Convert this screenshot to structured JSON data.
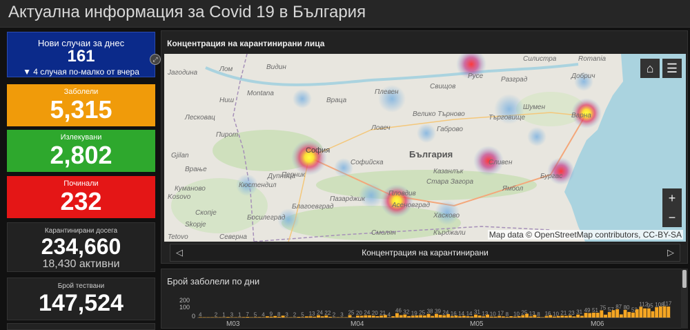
{
  "header": {
    "title": "Актуална информация за Covid 19 в България"
  },
  "cards": {
    "new": {
      "label": "Нови случаи за днес",
      "value": "161",
      "sub": "▼ 4 случая по-малко от вчера"
    },
    "sick": {
      "label": "Заболели",
      "value": "5,315"
    },
    "recovered": {
      "label": "Излекувани",
      "value": "2,802"
    },
    "dead": {
      "label": "Починали",
      "value": "232"
    },
    "quarantined": {
      "label": "Карантинирани досега",
      "value": "234,660",
      "sub": "18,430 активни"
    },
    "tests": {
      "label": "Брой тествани",
      "value": "147,524"
    }
  },
  "map_panel": {
    "title": "Концентрация на карантинирани лица",
    "attribution": "Map data © OpenStreetMap contributors, CC-BY-SA",
    "caption": "Концентрация на карантинирани",
    "zoom_in": "+",
    "zoom_out": "−",
    "labels": {
      "romania": "Romania",
      "dobrich": "Добрич",
      "silistra": "Силистра",
      "ruse": "Русе",
      "razgrad": "Разград",
      "pleven": "Плевен",
      "svishtov": "Свищов",
      "vratsa": "Враца",
      "montana": "Montana",
      "vidin": "Видин",
      "nish": "Ниш",
      "lovech": "Ловеч",
      "vtarnovo": "Велико Търново",
      "shumen": "Шумен",
      "targovishte": "Търговище",
      "gabrovo": "Габрово",
      "sofia": "София",
      "sofiyska": "Софийска",
      "bulgaria": "България",
      "kazanlak": "Казанлък",
      "sliven": "Сливен",
      "yambol": "Ямбол",
      "burgas": "Бургас",
      "varna": "Варна",
      "stzagora": "Стара Загора",
      "kyustendil": "Кюстендил",
      "pazardzhik": "Пазарджик",
      "plovdiv": "Пловдив",
      "asenovgrad": "Асеновград",
      "haskovo": "Хасково",
      "blagoevgrad": "Благоевград",
      "skopje": "Скопје",
      "severna": "Северна",
      "skopje2": "Skopje",
      "kosovo": "Kosovo",
      "pirot": "Пирот",
      "vranje": "Врање",
      "jagodina": "Јагодина",
      "tetovo": "Tetovo",
      "kumanovo": "Куманово",
      "pernik": "Перник",
      "gjilane": "Gjilan",
      "leskovac": "Лесковац",
      "kiustendil2": "Кърджали",
      "smolyan": "Смолян",
      "lom": "Лом",
      "dupnitsa": "Дупница",
      "bosilegrad": "Босилеград"
    }
  },
  "chart_panel": {
    "title": "Брой заболели по дни",
    "y_ticks": [
      "200",
      "100",
      "0"
    ],
    "x_ticks": [
      "M03",
      "M04",
      "M05",
      "M06"
    ]
  },
  "chart_data": {
    "type": "bar",
    "title": "Брой заболели по дни",
    "ylim": [
      0,
      200
    ],
    "x_ticks": [
      "M03",
      "M04",
      "M05",
      "M06"
    ],
    "values": [
      4,
      0,
      0,
      0,
      2,
      1,
      1,
      6,
      3,
      2,
      1,
      5,
      7,
      1,
      5,
      5,
      4,
      13,
      9,
      16,
      8,
      20,
      3,
      3,
      2,
      7,
      5,
      12,
      13,
      9,
      24,
      13,
      22,
      8,
      2,
      4,
      3,
      1,
      25,
      2,
      20,
      19,
      24,
      23,
      20,
      14,
      21,
      27,
      4,
      14,
      46,
      25,
      32,
      15,
      19,
      22,
      25,
      22,
      38,
      17,
      39,
      28,
      24,
      36,
      16,
      21,
      14,
      19,
      14,
      12,
      31,
      21,
      13,
      31,
      10,
      10,
      17,
      12,
      8,
      14,
      10,
      15,
      25,
      40,
      13,
      27,
      8,
      4,
      16,
      25,
      10,
      16,
      21,
      18,
      23,
      12,
      31,
      18,
      49,
      47,
      51,
      50,
      75,
      30,
      57,
      77,
      87,
      33,
      80,
      58,
      52,
      86,
      112,
      95,
      95,
      66,
      108,
      115,
      117,
      114
    ]
  }
}
